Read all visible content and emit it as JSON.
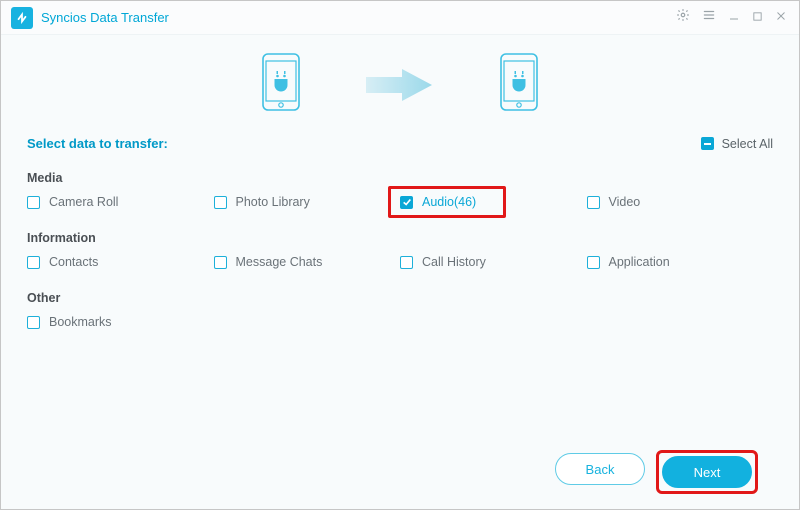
{
  "app": {
    "title": "Syncios Data Transfer"
  },
  "prompt": "Select data to transfer:",
  "select_all_label": "Select All",
  "groups": {
    "media_label": "Media",
    "info_label": "Information",
    "other_label": "Other"
  },
  "options": {
    "camera_roll": "Camera Roll",
    "photo_library": "Photo Library",
    "audio": "Audio(46)",
    "video": "Video",
    "contacts": "Contacts",
    "message_chats": "Message Chats",
    "call_history": "Call History",
    "application": "Application",
    "bookmarks": "Bookmarks"
  },
  "buttons": {
    "back": "Back",
    "next": "Next"
  }
}
